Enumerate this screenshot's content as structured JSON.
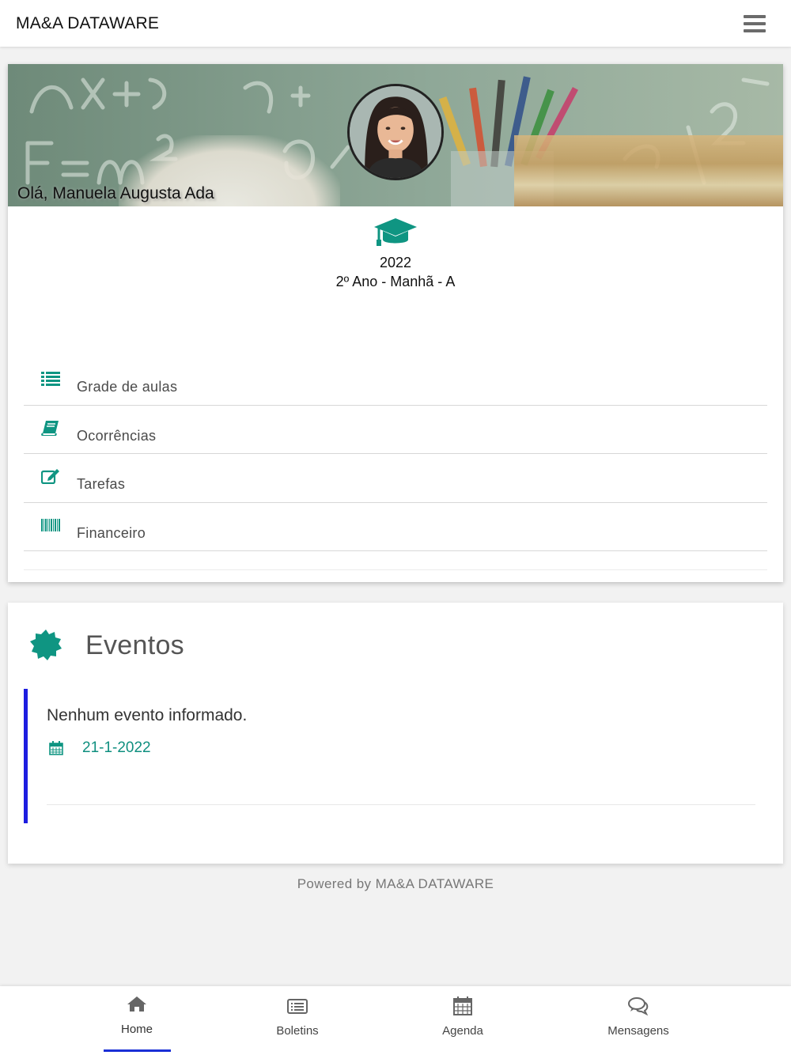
{
  "header": {
    "brand": "MA&A DATAWARE",
    "menu_icon": "hamburger-menu-icon"
  },
  "profile": {
    "greeting": "Olá, Manuela Augusta Ada",
    "class_icon": "graduation-cap-icon",
    "year": "2022",
    "class_name": "2º Ano - Manhã - A"
  },
  "menu": {
    "items": [
      {
        "label": "Grade de aulas",
        "icon": "list-icon"
      },
      {
        "label": "Ocorrências",
        "icon": "book-icon"
      },
      {
        "label": "Tarefas",
        "icon": "edit-icon"
      },
      {
        "label": "Financeiro",
        "icon": "barcode-icon"
      }
    ]
  },
  "events": {
    "icon": "certificate-star-icon",
    "title": "Eventos",
    "item": {
      "text": "Nenhum evento informado.",
      "date_icon": "calendar-icon",
      "date": "21-1-2022"
    }
  },
  "footer": {
    "powered": "Powered by MA&A DATAWARE"
  },
  "bottom_nav": {
    "items": [
      {
        "label": "Home",
        "icon": "home-icon",
        "active": true
      },
      {
        "label": "Boletins",
        "icon": "list-alt-icon",
        "active": false
      },
      {
        "label": "Agenda",
        "icon": "calendar-icon",
        "active": false
      },
      {
        "label": "Mensagens",
        "icon": "comments-icon",
        "active": false
      }
    ]
  },
  "colors": {
    "accent": "#0f9582",
    "event_border": "#1d1de0",
    "nav_underline": "#1a2fd6",
    "background": "#f2f2f2"
  }
}
